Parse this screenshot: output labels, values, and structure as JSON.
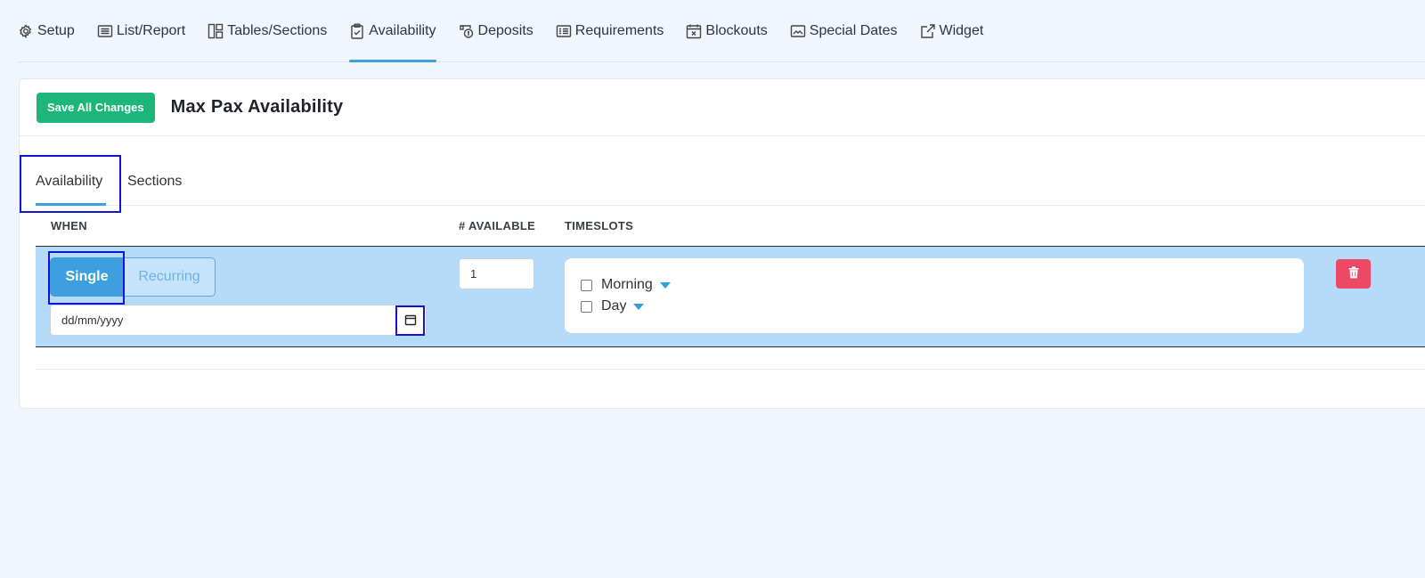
{
  "nav": {
    "items": [
      {
        "label": "Setup",
        "icon": "gear-icon"
      },
      {
        "label": "List/Report",
        "icon": "list-icon"
      },
      {
        "label": "Tables/Sections",
        "icon": "layout-icon"
      },
      {
        "label": "Availability",
        "icon": "clipboard-icon",
        "active": true
      },
      {
        "label": "Deposits",
        "icon": "deposit-icon"
      },
      {
        "label": "Requirements",
        "icon": "form-icon"
      },
      {
        "label": "Blockouts",
        "icon": "calendar-x-icon"
      },
      {
        "label": "Special Dates",
        "icon": "image-frame-icon"
      },
      {
        "label": "Widget",
        "icon": "external-link-icon"
      }
    ]
  },
  "header": {
    "save_label": "Save All Changes",
    "title": "Max Pax Availability"
  },
  "tabs": {
    "availability": "Availability",
    "sections": "Sections",
    "active": "Availability"
  },
  "table": {
    "headers": {
      "when": "WHEN",
      "available": "# AVAILABLE",
      "timeslots": "TIMESLOTS"
    },
    "row": {
      "mode_single": "Single",
      "mode_recurring": "Recurring",
      "mode_selected": "Single",
      "date_placeholder": "dd/mm/yyyy",
      "available_value": "1",
      "timeslots": [
        {
          "label": "Morning",
          "checked": false
        },
        {
          "label": "Day",
          "checked": false
        }
      ]
    }
  },
  "colors": {
    "accent": "#3aa0e0",
    "save_button": "#1cb57a",
    "row_highlight": "#b6dbf8",
    "delete_button": "#ec4966",
    "annotation_box": "#1414d8"
  }
}
